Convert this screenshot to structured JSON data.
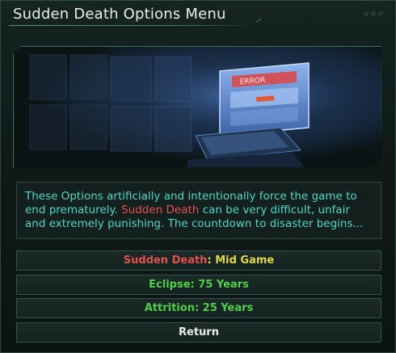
{
  "window": {
    "title": "Sudden Death Options Menu"
  },
  "banner": {
    "screen_text": "ERROR"
  },
  "description": {
    "part1": "These Options artificially and intentionally force the game to end prematurely. ",
    "highlight": "Sudden Death",
    "part2": " can be very difficult, unfair and extremely punishing. The countdown to disaster begins..."
  },
  "options": {
    "sudden_death_label": "Sudden Death",
    "sudden_death_sep": ": ",
    "sudden_death_value": "Mid Game",
    "eclipse": "Eclipse: 75 Years",
    "attrition": "Attrition: 25 Years",
    "return": "Return"
  },
  "colors": {
    "accent_teal": "#52d7c6",
    "highlight_red": "#e05250",
    "value_yellow": "#dfd94c",
    "option_green": "#4fcf4a"
  }
}
